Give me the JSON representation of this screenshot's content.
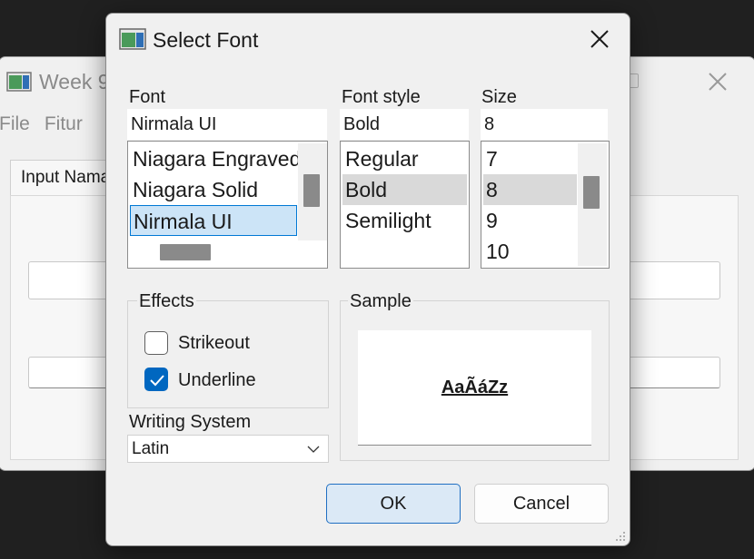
{
  "background_window": {
    "title": "Week 9",
    "menu": [
      "File",
      "Fitur"
    ],
    "tab_label": "Input Nama"
  },
  "dialog": {
    "title": "Select Font",
    "font": {
      "label": "Font",
      "value": "Nirmala UI",
      "items": [
        "Niagara Engraved",
        "Niagara Solid",
        "Nirmala UI"
      ],
      "selected_index": 2
    },
    "style": {
      "label": "Font style",
      "value": "Bold",
      "items": [
        "Regular",
        "Bold",
        "Semilight"
      ],
      "selected_index": 1
    },
    "size": {
      "label": "Size",
      "value": "8",
      "items": [
        "7",
        "8",
        "9",
        "10"
      ],
      "selected_index": 1
    },
    "effects": {
      "label": "Effects",
      "strikeout": {
        "label": "Strikeout",
        "checked": false
      },
      "underline": {
        "label": "Underline",
        "checked": true
      }
    },
    "writing_system": {
      "label": "Writing System",
      "value": "Latin"
    },
    "sample": {
      "label": "Sample",
      "text": "AaÃáZz"
    },
    "buttons": {
      "ok": "OK",
      "cancel": "Cancel"
    }
  },
  "colors": {
    "accent": "#0067c0",
    "selection_blue": "#cce4f7",
    "selection_gray": "#d9d9d9",
    "desktop": "#202020"
  }
}
